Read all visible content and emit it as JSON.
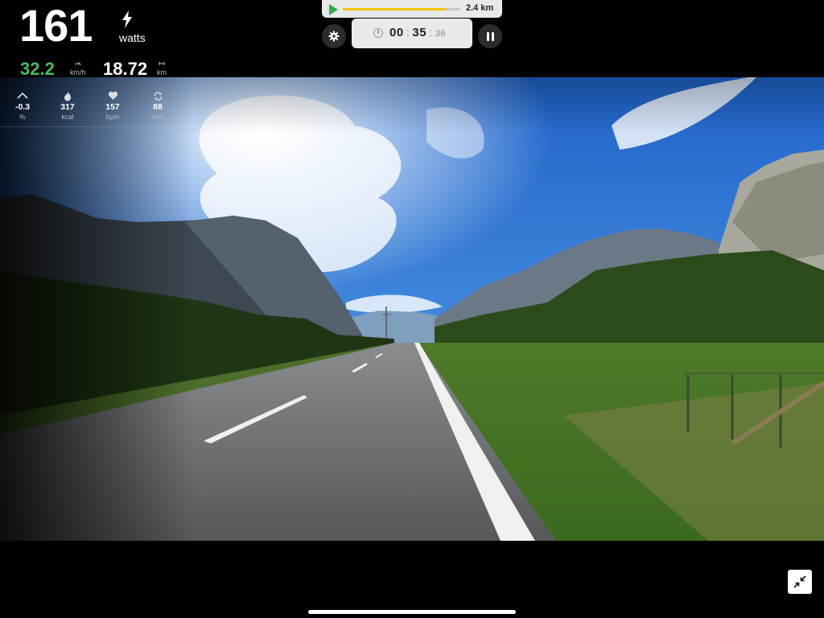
{
  "power": {
    "value": "161",
    "unit": "watts"
  },
  "speed": {
    "value": "32.2",
    "unit": "km/h"
  },
  "distance": {
    "value": "18.72",
    "unit": "km"
  },
  "stats": [
    {
      "value": "-0.3",
      "unit": "%",
      "icon": "grade-icon"
    },
    {
      "value": "317",
      "unit": "kcal",
      "icon": "flame-icon"
    },
    {
      "value": "157",
      "unit": "bpm",
      "icon": "heart-icon"
    },
    {
      "value": "88",
      "unit": "rpm",
      "icon": "cadence-icon"
    }
  ],
  "route": {
    "remaining": "2.4 km",
    "progress_fraction": 0.88
  },
  "timer": {
    "hours": "00",
    "minutes": "35",
    "seconds": "36"
  },
  "colors": {
    "speed": "#4cbb5f",
    "progress": "#f2c400",
    "play": "#2fb14a"
  }
}
